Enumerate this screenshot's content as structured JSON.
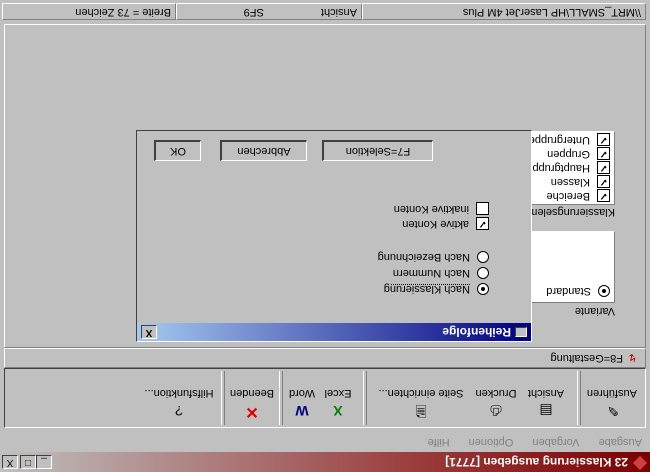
{
  "window": {
    "title": "23 Klassierung ausgeben [7771]",
    "controls": [
      "_",
      "□",
      "X"
    ]
  },
  "menu": [
    "Ausgabe",
    "Vorgaben",
    "Optionen",
    "Hilfe"
  ],
  "toolbar": {
    "groups": [
      {
        "label": "Ausführen",
        "icon": "pencil-icon"
      },
      {
        "label": "Ansicht",
        "icon": "view-icon"
      },
      {
        "label": "Drucken",
        "icon": "printer-icon"
      },
      {
        "label": "Seite einrichten...",
        "icon": "page-setup-icon"
      },
      {
        "label": "Excel",
        "icon": "excel-icon"
      },
      {
        "label": "Word",
        "icon": "word-icon"
      },
      {
        "label": "Beenden",
        "icon": "close-red-icon"
      },
      {
        "label": "Hilfsfunktion...",
        "icon": "help-icon"
      }
    ]
  },
  "hint_bar": {
    "text": "F8=Gestaltung"
  },
  "variant": {
    "label": "Variante",
    "items": [
      "Standard"
    ],
    "selected": "Standard"
  },
  "classification_elements": {
    "label": "Klassierungselemente",
    "items": [
      {
        "label": "Bereiche",
        "checked": true
      },
      {
        "label": "Klassen",
        "checked": true
      },
      {
        "label": "Hauptgruppen",
        "checked": true
      },
      {
        "label": "Gruppen",
        "checked": true
      },
      {
        "label": "Untergruppen",
        "checked": true
      }
    ]
  },
  "dialog": {
    "title": "Reihenfolge",
    "close_label": "X",
    "sort_options": [
      {
        "label": "Nach Klassierung",
        "selected": true
      },
      {
        "label": "Nach Nummern",
        "selected": false
      },
      {
        "label": "Nach Bezeichnung",
        "selected": false
      }
    ],
    "active_accounts": {
      "label": "aktive Konten",
      "checked": true
    },
    "inactive_accounts": {
      "label": "inaktive Konten",
      "checked": false
    },
    "buttons": {
      "ok": "OK",
      "cancel": "Abbrechen",
      "selection": "F7=Selektion"
    }
  },
  "status": {
    "width": "Breite = 73 Zeichen",
    "view": "Ansicht",
    "view_key": "SF9",
    "printer": "\\\\MRT_SMALL\\HP LaserJet 4M Plus"
  }
}
